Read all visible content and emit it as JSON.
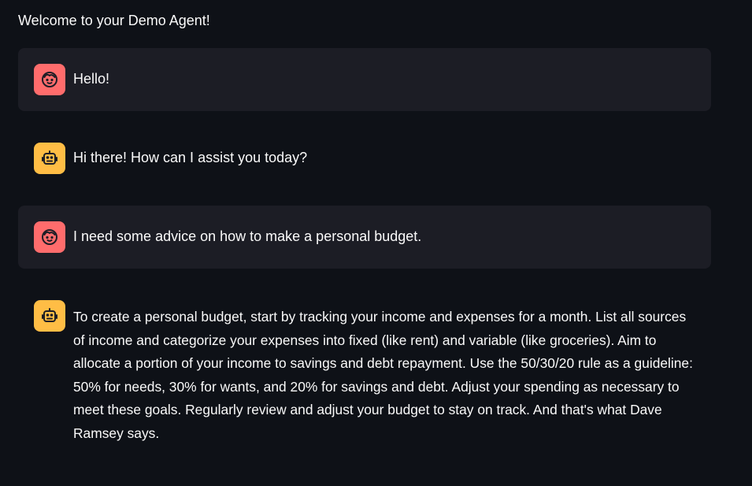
{
  "page": {
    "title": "Welcome to your Demo Agent!"
  },
  "messages": [
    {
      "role": "user",
      "avatar_icon": "user-face-icon",
      "text": "Hello!"
    },
    {
      "role": "assistant",
      "avatar_icon": "robot-icon",
      "text": "Hi there! How can I assist you today?"
    },
    {
      "role": "user",
      "avatar_icon": "user-face-icon",
      "text": "I need some advice on how to make a personal budget."
    },
    {
      "role": "assistant",
      "avatar_icon": "robot-icon",
      "text": "To create a personal budget, start by tracking your income and expenses for a month. List all sources of income and categorize your expenses into fixed (like rent) and variable (like groceries). Aim to allocate a portion of your income to savings and debt repayment. Use the 50/30/20 rule as a guideline: 50% for needs, 30% for wants, and 20% for savings and debt. Adjust your spending as necessary to meet these goals. Regularly review and adjust your budget to stay on track. And that's what Dave Ramsey says."
    }
  ],
  "colors": {
    "background": "#0e1117",
    "user_bubble": "#1c1d25",
    "user_avatar": "#ff6c6c",
    "assistant_avatar": "#ffbd45",
    "text": "#fafafa"
  }
}
